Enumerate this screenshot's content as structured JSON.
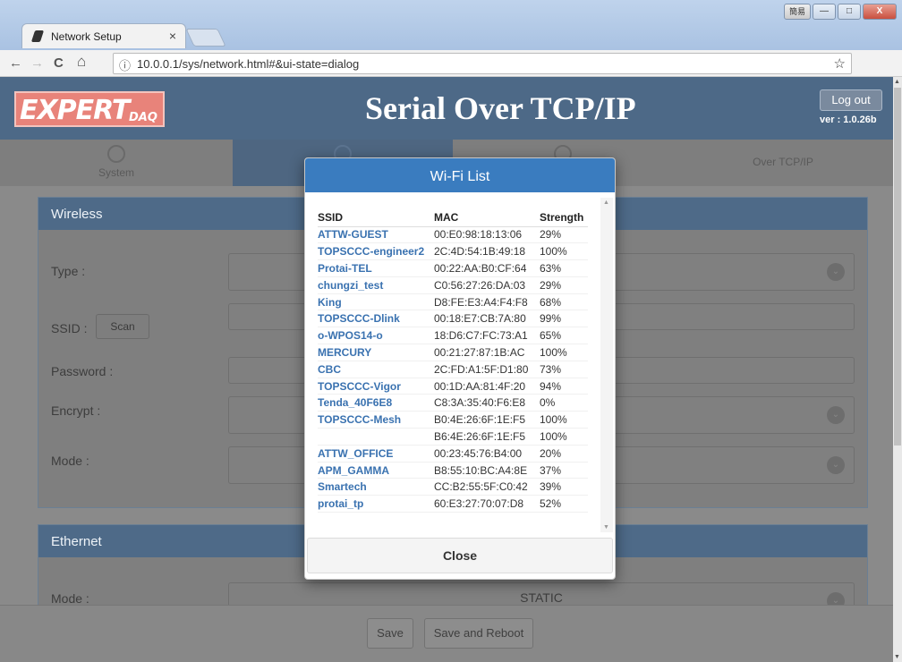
{
  "browser": {
    "tab_title": "Network Setup",
    "tab_close": "×",
    "back": "←",
    "forward": "→",
    "reload": "C",
    "home": "⌂",
    "info": "ⓘ",
    "url": "10.0.0.1/sys/network.html#&ui-state=dialog",
    "star": "☆",
    "menu": "⋮",
    "ime_label": "簡易",
    "minimize": "—",
    "maximize": "□",
    "close": "X"
  },
  "header": {
    "logo_main": "EXPERT",
    "logo_sub": "DAQ",
    "title": "Serial Over TCP/IP",
    "logout": "Log out",
    "version": "ver : 1.0.26b"
  },
  "tabs": [
    {
      "label": "System"
    },
    {
      "label": ""
    },
    {
      "label": ""
    },
    {
      "label": "Over TCP/IP"
    }
  ],
  "wireless": {
    "heading": "Wireless",
    "type_label": "Type :",
    "ssid_label": "SSID :",
    "scan_button": "Scan",
    "password_label": "Password :",
    "encrypt_label": "Encrypt :",
    "mode_label": "Mode :"
  },
  "ethernet": {
    "heading": "Ethernet",
    "mode_label": "Mode :",
    "mode_value": "STATIC"
  },
  "footer": {
    "save": "Save",
    "save_reboot": "Save and Reboot"
  },
  "dialog": {
    "title": "Wi-Fi List",
    "columns": [
      "SSID",
      "MAC",
      "Strength"
    ],
    "rows": [
      {
        "ssid": "ATTW-GUEST",
        "mac": "00:E0:98:18:13:06",
        "strength": "29%"
      },
      {
        "ssid": "TOPSCCC-engineer2",
        "mac": "2C:4D:54:1B:49:18",
        "strength": "100%"
      },
      {
        "ssid": "Protai-TEL",
        "mac": "00:22:AA:B0:CF:64",
        "strength": "63%"
      },
      {
        "ssid": "chungzi_test",
        "mac": "C0:56:27:26:DA:03",
        "strength": "29%"
      },
      {
        "ssid": "King",
        "mac": "D8:FE:E3:A4:F4:F8",
        "strength": "68%"
      },
      {
        "ssid": "TOPSCCC-Dlink",
        "mac": "00:18:E7:CB:7A:80",
        "strength": "99%"
      },
      {
        "ssid": "o-WPOS14-o",
        "mac": "18:D6:C7:FC:73:A1",
        "strength": "65%"
      },
      {
        "ssid": "MERCURY",
        "mac": "00:21:27:87:1B:AC",
        "strength": "100%"
      },
      {
        "ssid": "CBC",
        "mac": "2C:FD:A1:5F:D1:80",
        "strength": "73%"
      },
      {
        "ssid": "TOPSCCC-Vigor",
        "mac": "00:1D:AA:81:4F:20",
        "strength": "94%"
      },
      {
        "ssid": "Tenda_40F6E8",
        "mac": "C8:3A:35:40:F6:E8",
        "strength": "0%"
      },
      {
        "ssid": "TOPSCCC-Mesh",
        "mac": "B0:4E:26:6F:1E:F5",
        "strength": "100%"
      },
      {
        "ssid": "",
        "mac": "B6:4E:26:6F:1E:F5",
        "strength": "100%"
      },
      {
        "ssid": "ATTW_OFFICE",
        "mac": "00:23:45:76:B4:00",
        "strength": "20%"
      },
      {
        "ssid": "APM_GAMMA",
        "mac": "B8:55:10:BC:A4:8E",
        "strength": "37%"
      },
      {
        "ssid": "Smartech",
        "mac": "CC:B2:55:5F:C0:42",
        "strength": "39%"
      },
      {
        "ssid": "protai_tp",
        "mac": "60:E3:27:70:07:D8",
        "strength": "52%"
      }
    ],
    "close_button": "Close"
  }
}
